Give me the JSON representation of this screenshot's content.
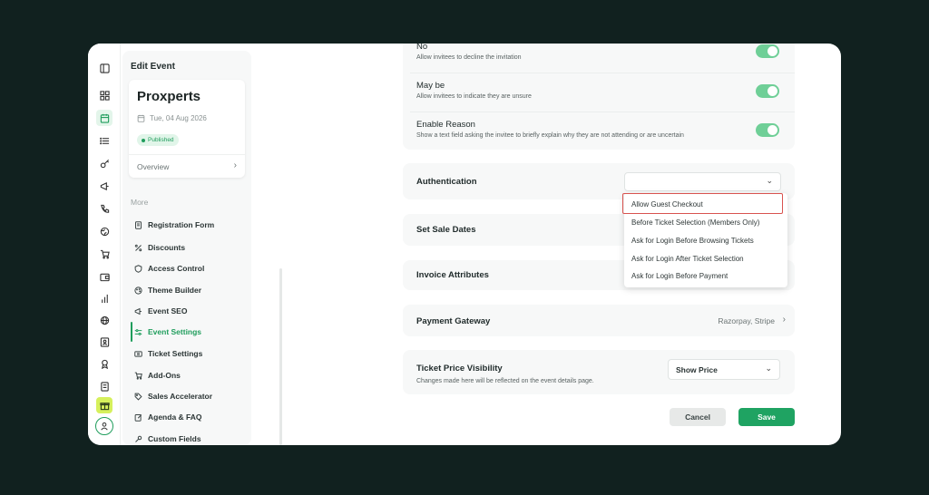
{
  "left_panel": {
    "title": "Edit Event",
    "event": {
      "name": "Proxperts",
      "date": "Tue, 04 Aug 2026",
      "status": "Published",
      "overview_label": "Overview"
    },
    "more_label": "More",
    "menu": [
      {
        "label": "Registration Form",
        "icon": "form-icon"
      },
      {
        "label": "Discounts",
        "icon": "percent-icon"
      },
      {
        "label": "Access Control",
        "icon": "shield-icon"
      },
      {
        "label": "Theme Builder",
        "icon": "palette-icon"
      },
      {
        "label": "Event SEO",
        "icon": "megaphone-icon"
      },
      {
        "label": "Event Settings",
        "icon": "sliders-icon",
        "active": true
      },
      {
        "label": "Ticket Settings",
        "icon": "ticket-icon"
      },
      {
        "label": "Add-Ons",
        "icon": "cart-icon"
      },
      {
        "label": "Sales Accelerator",
        "icon": "tag-icon"
      },
      {
        "label": "Agenda & FAQ",
        "icon": "edit-icon"
      },
      {
        "label": "Custom Fields",
        "icon": "wrench-icon"
      }
    ]
  },
  "rsvp_options": [
    {
      "title": "No",
      "desc": "Allow invitees to decline the invitation",
      "enabled": true
    },
    {
      "title": "May be",
      "desc": "Allow invitees to indicate they are unsure",
      "enabled": true
    },
    {
      "title": "Enable Reason",
      "desc": "Show a text field asking the invitee to briefly explain why they are not attending or are uncertain",
      "enabled": true
    }
  ],
  "sections": {
    "authentication": "Authentication",
    "set_sale_dates": "Set Sale Dates",
    "invoice_attributes": "Invoice Attributes",
    "payment_gateway": "Payment Gateway",
    "payment_gateway_value": "Razorpay, Stripe",
    "ticket_price_visibility": "Ticket Price Visibility",
    "ticket_price_visibility_desc": "Changes made here will be reflected on the event details page.",
    "ticket_price_visibility_value": "Show Price"
  },
  "authentication_options": [
    "Allow Guest Checkout",
    "Before Ticket Selection (Members Only)",
    "Ask for Login Before Browsing Tickets",
    "Ask for Login After Ticket Selection",
    "Ask for Login Before Payment"
  ],
  "highlighted_option_index": 0,
  "buttons": {
    "cancel": "Cancel",
    "save": "Save"
  },
  "colors": {
    "accent": "#1fa362",
    "toggle_on": "#6fcf97",
    "highlight_border": "#d9534f",
    "background": "#11211f"
  }
}
